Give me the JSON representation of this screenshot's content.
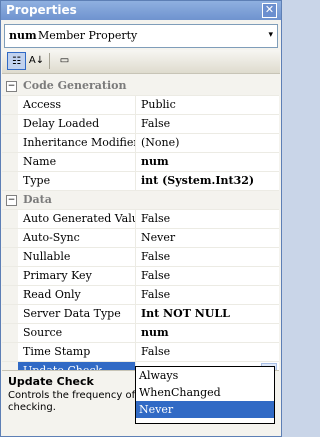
{
  "window": {
    "title": "Properties",
    "close_glyph": "✕"
  },
  "selector": {
    "object_name": "num",
    "object_type": "Member Property",
    "arrow": "▾"
  },
  "toolbar": {
    "categorized_glyph": "☷",
    "alphabetical_glyph": "A↓",
    "pages_glyph": "▭"
  },
  "categories": [
    {
      "label": "Code Generation",
      "toggle": "−",
      "properties": [
        {
          "name": "Access",
          "value": "Public",
          "bold": false
        },
        {
          "name": "Delay Loaded",
          "value": "False",
          "bold": false
        },
        {
          "name": "Inheritance Modifier",
          "value": "(None)",
          "bold": false
        },
        {
          "name": "Name",
          "value": "num",
          "bold": true
        },
        {
          "name": "Type",
          "value": "int (System.Int32)",
          "bold": true
        }
      ]
    },
    {
      "label": "Data",
      "toggle": "−",
      "properties": [
        {
          "name": "Auto Generated Value",
          "value": "False",
          "bold": false
        },
        {
          "name": "Auto-Sync",
          "value": "Never",
          "bold": false
        },
        {
          "name": "Nullable",
          "value": "False",
          "bold": false
        },
        {
          "name": "Primary Key",
          "value": "False",
          "bold": false
        },
        {
          "name": "Read Only",
          "value": "False",
          "bold": false
        },
        {
          "name": "Server Data Type",
          "value": "Int NOT NULL",
          "bold": true
        },
        {
          "name": "Source",
          "value": "num",
          "bold": true
        },
        {
          "name": "Time Stamp",
          "value": "False",
          "bold": false
        },
        {
          "name": "Update Check",
          "value": "Never",
          "bold": true,
          "selected": true
        }
      ]
    }
  ],
  "dropdown": {
    "arrow": "▼",
    "options": [
      "Always",
      "WhenChanged",
      "Never"
    ],
    "selected_index": 2
  },
  "description": {
    "title": "Update Check",
    "text": "Controls the frequency of d",
    "text2": "checking."
  },
  "colors": {
    "selection": "#316ac5",
    "title_bar": "#7a9cd6"
  }
}
